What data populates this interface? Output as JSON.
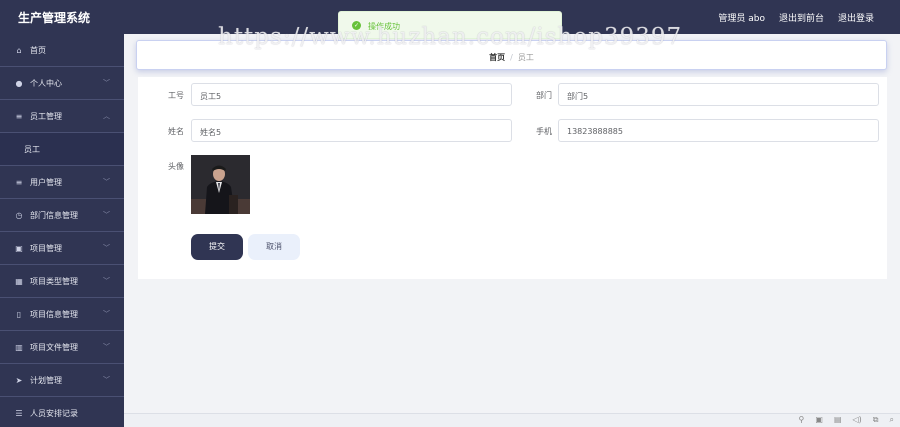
{
  "header": {
    "brand": "生产管理系统",
    "user": "管理员 abo",
    "back_to_console": "退出到前台",
    "logout": "退出登录"
  },
  "sidebar": {
    "items": [
      {
        "label": "首页",
        "icon": "home-icon"
      },
      {
        "label": "个人中心",
        "icon": "user-icon"
      },
      {
        "label": "员工管理",
        "icon": "menu-icon"
      },
      {
        "label": "员工",
        "icon": ""
      },
      {
        "label": "用户管理",
        "icon": "menu-icon"
      },
      {
        "label": "部门信息管理",
        "icon": "clock-icon"
      },
      {
        "label": "项目管理",
        "icon": "folder-icon"
      },
      {
        "label": "项目类型管理",
        "icon": "grid-icon"
      },
      {
        "label": "项目信息管理",
        "icon": "mic-icon"
      },
      {
        "label": "项目文件管理",
        "icon": "chart-icon"
      },
      {
        "label": "计划管理",
        "icon": "send-icon"
      },
      {
        "label": "人员安排记录",
        "icon": "list-icon"
      }
    ]
  },
  "breadcrumb": {
    "home": "首页",
    "separator": "/",
    "current": "员工"
  },
  "form": {
    "labels": {
      "emp_no": "工号",
      "dept": "部门",
      "name": "姓名",
      "phone": "手机",
      "avatar": "头像"
    },
    "values": {
      "emp_no": "员工5",
      "dept": "部门5",
      "name": "姓名5",
      "phone": "13823888885"
    },
    "submit": "提交",
    "cancel": "取消"
  },
  "toast": {
    "message": "操作成功"
  },
  "watermark": "https://www.huzhan.com/ishop39397",
  "colors": {
    "sidebar": "#303553",
    "accent": "#303553",
    "success": "#67c23a"
  }
}
